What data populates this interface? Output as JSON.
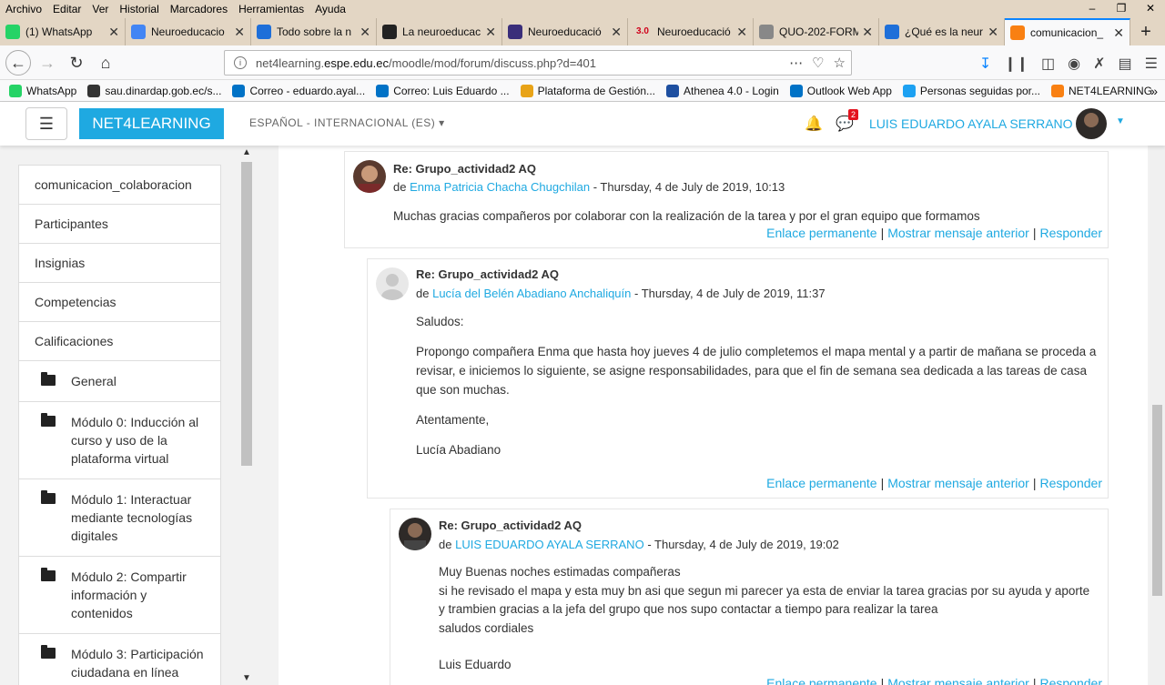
{
  "browser": {
    "menu": [
      "Archivo",
      "Editar",
      "Ver",
      "Historial",
      "Marcadores",
      "Herramientas",
      "Ayuda"
    ],
    "tabs": [
      {
        "label": "(1) WhatsApp",
        "icon": "whatsapp-icon",
        "color": "#25d366"
      },
      {
        "label": "Neuroeducacio",
        "icon": "google-icon",
        "color": "#4285f4"
      },
      {
        "label": "Todo sobre la n",
        "icon": "bookmark-icon",
        "color": "#1e6fd9"
      },
      {
        "label": "La neuroeducac",
        "icon": "letter-e-icon",
        "color": "#222222"
      },
      {
        "label": "Neuroeducació",
        "icon": "shield-icon",
        "color": "#3a2e7a"
      },
      {
        "label": "Neuroeducació",
        "icon": "number-icon",
        "color": "#d0021b",
        "prefix": "3.0"
      },
      {
        "label": "QUO-202-FORM",
        "icon": "document-icon",
        "color": "#888888"
      },
      {
        "label": "¿Qué es la neur",
        "icon": "book-icon",
        "color": "#1e6fd9"
      },
      {
        "label": "comunicacion_",
        "icon": "moodle-icon",
        "color": "#f98012"
      }
    ],
    "url_prefix": "net4learning.",
    "url_domain": "espe.edu.ec",
    "url_path": "/moodle/mod/forum/discuss.php?d=401",
    "bookmarks": [
      {
        "label": "WhatsApp",
        "color": "#25d366"
      },
      {
        "label": "sau.dinardap.gob.ec/s...",
        "color": "#333333"
      },
      {
        "label": "Correo - eduardo.ayal...",
        "color": "#0072c6"
      },
      {
        "label": "Correo: Luis Eduardo ...",
        "color": "#0072c6"
      },
      {
        "label": "Plataforma de Gestión...",
        "color": "#e8a317"
      },
      {
        "label": "Athenea 4.0 - Login",
        "color": "#1e4fa0"
      },
      {
        "label": "Outlook Web App",
        "color": "#0072c6"
      },
      {
        "label": "Personas seguidas por...",
        "color": "#1da1f2"
      },
      {
        "label": "NET4LEARNING",
        "color": "#f98012"
      }
    ]
  },
  "header": {
    "brand": "NET4LEARNING",
    "language": "ESPAÑOL - INTERNACIONAL (ES)",
    "message_count": "2",
    "user_name": "LUIS EDUARDO AYALA SERRANO"
  },
  "sidebar": {
    "items": [
      {
        "label": "comunicacion_colaboracion",
        "type": "link"
      },
      {
        "label": "Participantes",
        "type": "link"
      },
      {
        "label": "Insignias",
        "type": "link"
      },
      {
        "label": "Competencias",
        "type": "link"
      },
      {
        "label": "Calificaciones",
        "type": "link"
      },
      {
        "label": "General",
        "type": "folder"
      },
      {
        "label": "Módulo 0: Inducción al curso y uso de la plataforma virtual",
        "type": "folder"
      },
      {
        "label": "Módulo 1: Interactuar mediante tecnologías digitales",
        "type": "folder"
      },
      {
        "label": "Módulo 2: Compartir información y contenidos",
        "type": "folder"
      },
      {
        "label": "Módulo 3: Participación ciudadana en línea",
        "type": "folder"
      }
    ]
  },
  "posts": [
    {
      "title": "Re: Grupo_actividad2 AQ",
      "by": "de",
      "author": "Enma Patricia Chacha Chugchilan",
      "date": "- Thursday, 4 de July de 2019, 10:13",
      "body": [
        "Muchas gracias compañeros por colaborar con la realización de la tarea y por el gran equipo que formamos"
      ],
      "links": [
        "Enlace permanente",
        "Mostrar mensaje anterior",
        "Responder"
      ]
    },
    {
      "title": "Re: Grupo_actividad2 AQ",
      "by": "de",
      "author": "Lucía del Belén Abadiano Anchaliquín",
      "date": "- Thursday, 4 de July de 2019, 11:37",
      "body": [
        "Saludos:",
        "Propongo compañera Enma que hasta hoy jueves 4 de julio completemos el mapa mental y a partir de mañana se proceda a revisar, e  iniciemos lo siguiente, se asigne responsabilidades, para que el fin de semana sea dedicada a las tareas de casa que son muchas.",
        "Atentamente,",
        "Lucía Abadiano"
      ],
      "links": [
        "Enlace permanente",
        "Mostrar mensaje anterior",
        "Responder"
      ]
    },
    {
      "title": "Re: Grupo_actividad2 AQ",
      "by": "de",
      "author": "LUIS EDUARDO AYALA SERRANO",
      "date": "- Thursday, 4 de July de 2019, 19:02",
      "body": [
        "Muy Buenas noches estimadas compañeras",
        "si he revisado el mapa y esta muy bn asi que segun mi parecer ya esta de enviar la tarea gracias por su ayuda y aporte y trambien gracias a la jefa del grupo que nos supo contactar a tiempo para realizar la tarea",
        "saludos cordiales",
        "",
        "Luis Eduardo"
      ],
      "links": [
        "Enlace permanente",
        "Mostrar mensaje anterior",
        "Responder"
      ]
    }
  ]
}
